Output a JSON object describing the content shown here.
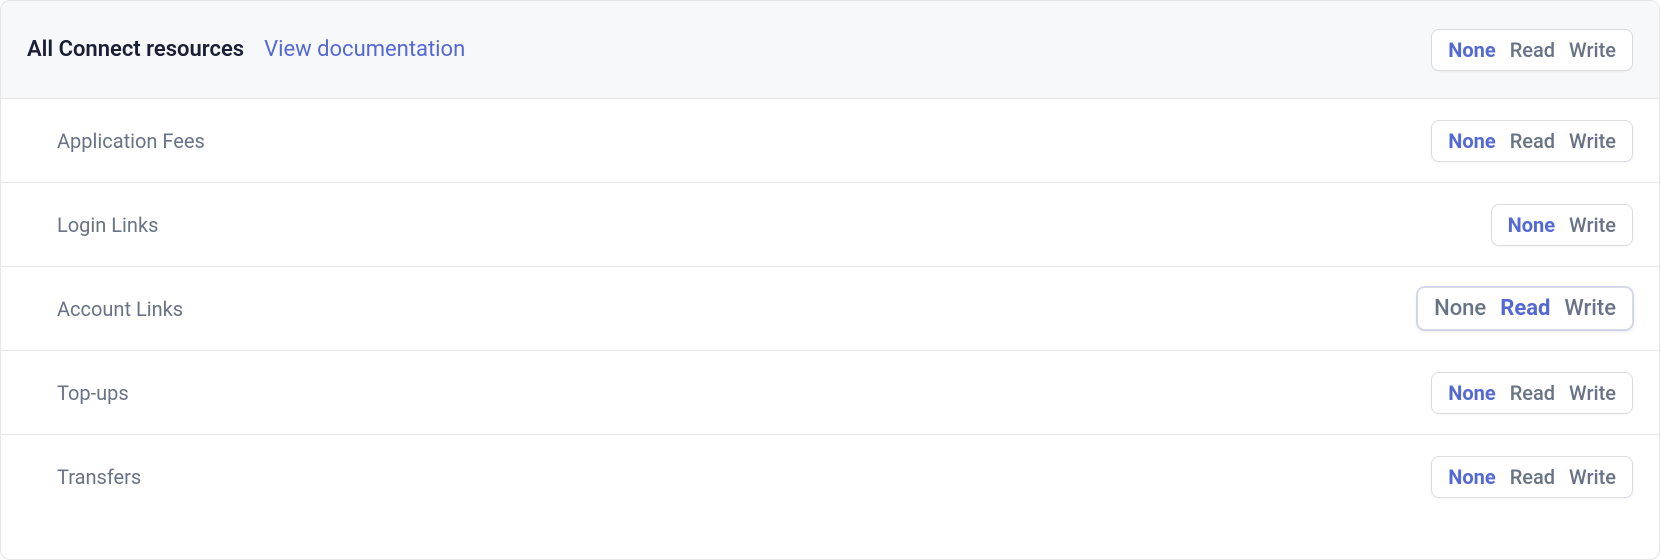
{
  "header": {
    "title": "All Connect resources",
    "doc_link": "View documentation",
    "options": [
      "None",
      "Read",
      "Write"
    ],
    "selected": "None",
    "focused": false
  },
  "rows": [
    {
      "label": "Application Fees",
      "options": [
        "None",
        "Read",
        "Write"
      ],
      "selected": "None",
      "focused": false
    },
    {
      "label": "Login Links",
      "options": [
        "None",
        "Write"
      ],
      "selected": "None",
      "focused": false
    },
    {
      "label": "Account Links",
      "options": [
        "None",
        "Read",
        "Write"
      ],
      "selected": "Read",
      "focused": true
    },
    {
      "label": "Top-ups",
      "options": [
        "None",
        "Read",
        "Write"
      ],
      "selected": "None",
      "focused": false
    },
    {
      "label": "Transfers",
      "options": [
        "None",
        "Read",
        "Write"
      ],
      "selected": "None",
      "focused": false
    }
  ],
  "colors": {
    "accent": "#5469d4",
    "muted": "#697386",
    "border": "#e6e6e6"
  }
}
